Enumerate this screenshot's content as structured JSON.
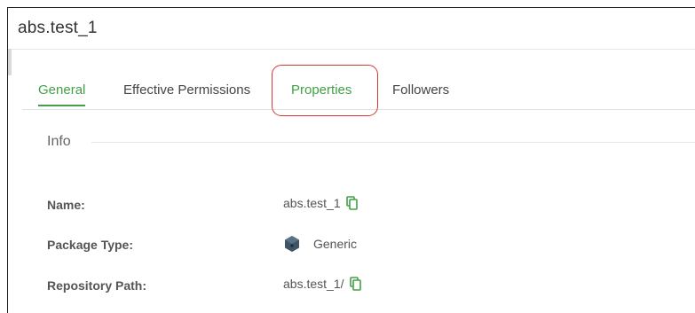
{
  "header": {
    "title": "abs.test_1"
  },
  "tabs": [
    {
      "label": "General",
      "active": true
    },
    {
      "label": "Effective Permissions",
      "active": false
    },
    {
      "label": "Properties",
      "active": false
    },
    {
      "label": "Followers",
      "active": false
    }
  ],
  "info": {
    "section_title": "Info",
    "rows": [
      {
        "label": "Name:",
        "value": "abs.test_1"
      },
      {
        "label": "Package Type:",
        "value": "Generic"
      },
      {
        "label": "Repository Path:",
        "value": "abs.test_1/"
      }
    ]
  },
  "colors": {
    "accent": "#43a047",
    "highlight": "#d9392e"
  },
  "icons": {
    "copy": "copy-icon",
    "package": "package-icon"
  }
}
